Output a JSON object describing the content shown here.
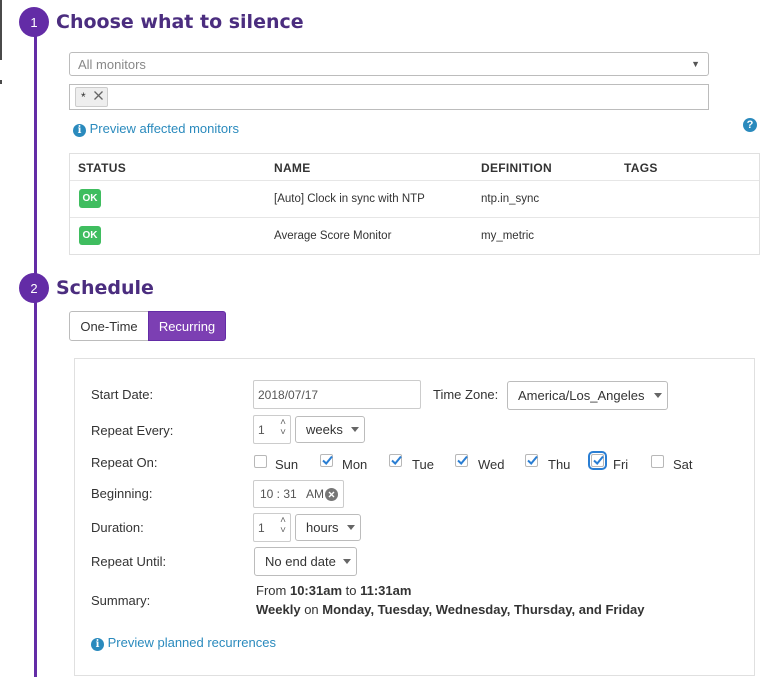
{
  "step1": {
    "number": "1",
    "title": "Choose what to silence"
  },
  "monitor_select": {
    "value": "All monitors"
  },
  "scope_tags": [
    {
      "label": "*"
    }
  ],
  "preview_monitors_link": "Preview affected monitors",
  "table": {
    "headers": [
      "STATUS",
      "NAME",
      "DEFINITION",
      "TAGS"
    ],
    "rows": [
      {
        "status": "OK",
        "name": "[Auto] Clock in sync with NTP",
        "definition": "ntp.in_sync",
        "tags": ""
      },
      {
        "status": "OK",
        "name": "Average Score Monitor",
        "definition": "my_metric",
        "tags": ""
      }
    ]
  },
  "step2": {
    "number": "2",
    "title": "Schedule"
  },
  "schedule_tabs": [
    {
      "label": "One-Time",
      "active": false
    },
    {
      "label": "Recurring",
      "active": true
    }
  ],
  "form": {
    "start_date_label": "Start Date:",
    "start_date": "2018/07/17",
    "timezone_label": "Time Zone:",
    "timezone": "America/Los_Angeles",
    "repeat_every_label": "Repeat Every:",
    "repeat_every_value": "1",
    "repeat_every_unit": "weeks",
    "repeat_on_label": "Repeat On:",
    "days": [
      {
        "label": "Sun",
        "checked": false
      },
      {
        "label": "Mon",
        "checked": true
      },
      {
        "label": "Tue",
        "checked": true
      },
      {
        "label": "Wed",
        "checked": true
      },
      {
        "label": "Thu",
        "checked": true
      },
      {
        "label": "Fri",
        "checked": true
      },
      {
        "label": "Sat",
        "checked": false
      }
    ],
    "beginning_label": "Beginning:",
    "beginning_time": "10 : 31   AM",
    "duration_label": "Duration:",
    "duration_value": "1",
    "duration_unit": "hours",
    "repeat_until_label": "Repeat Until:",
    "repeat_until": "No end date",
    "summary_label": "Summary:",
    "summary": {
      "from_word": "From",
      "start": "10:31am",
      "to_word": "to",
      "end": "11:31am",
      "frequency": "Weekly",
      "on_word": "on",
      "days_text": "Monday, Tuesday, Wednesday, Thursday, and Friday"
    }
  },
  "preview_recurrences_link": "Preview planned recurrences",
  "colors": {
    "accent": "#632ca6",
    "ok": "#3fbd5f",
    "link": "#2a8abd",
    "checkbox": "#2a7ed3"
  }
}
